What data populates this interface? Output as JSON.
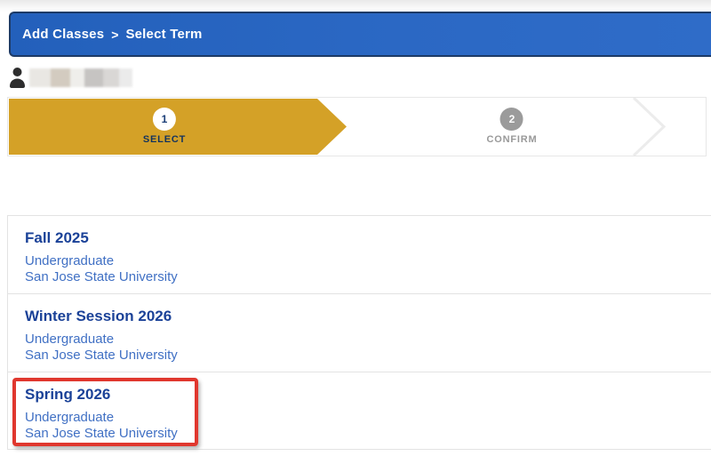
{
  "header": {
    "breadcrumb": [
      "Add Classes",
      "Select Term"
    ],
    "separator": ">"
  },
  "user": {
    "icon": "person-icon",
    "name_redacted": true
  },
  "progress": {
    "steps": [
      {
        "number": "1",
        "label": "SELECT",
        "state": "active"
      },
      {
        "number": "2",
        "label": "CONFIRM",
        "state": "inactive"
      }
    ]
  },
  "terms": {
    "items": [
      {
        "name": "Fall 2025",
        "career": "Undergraduate",
        "institution": "San Jose State University",
        "highlighted": false
      },
      {
        "name": "Winter Session 2026",
        "career": "Undergraduate",
        "institution": "San Jose State University",
        "highlighted": false
      },
      {
        "name": "Spring 2026",
        "career": "Undergraduate",
        "institution": "San Jose State University",
        "highlighted": true
      }
    ]
  },
  "colors": {
    "header-blue": "#2b68c4",
    "header-border": "#1d3a66",
    "step-gold": "#d4a127",
    "step-active-text": "#13335e",
    "step-inactive": "#9b9b9b",
    "term-title-blue": "#1b4298",
    "term-sub-blue": "#4070c4",
    "highlight-red": "#e0372e"
  }
}
